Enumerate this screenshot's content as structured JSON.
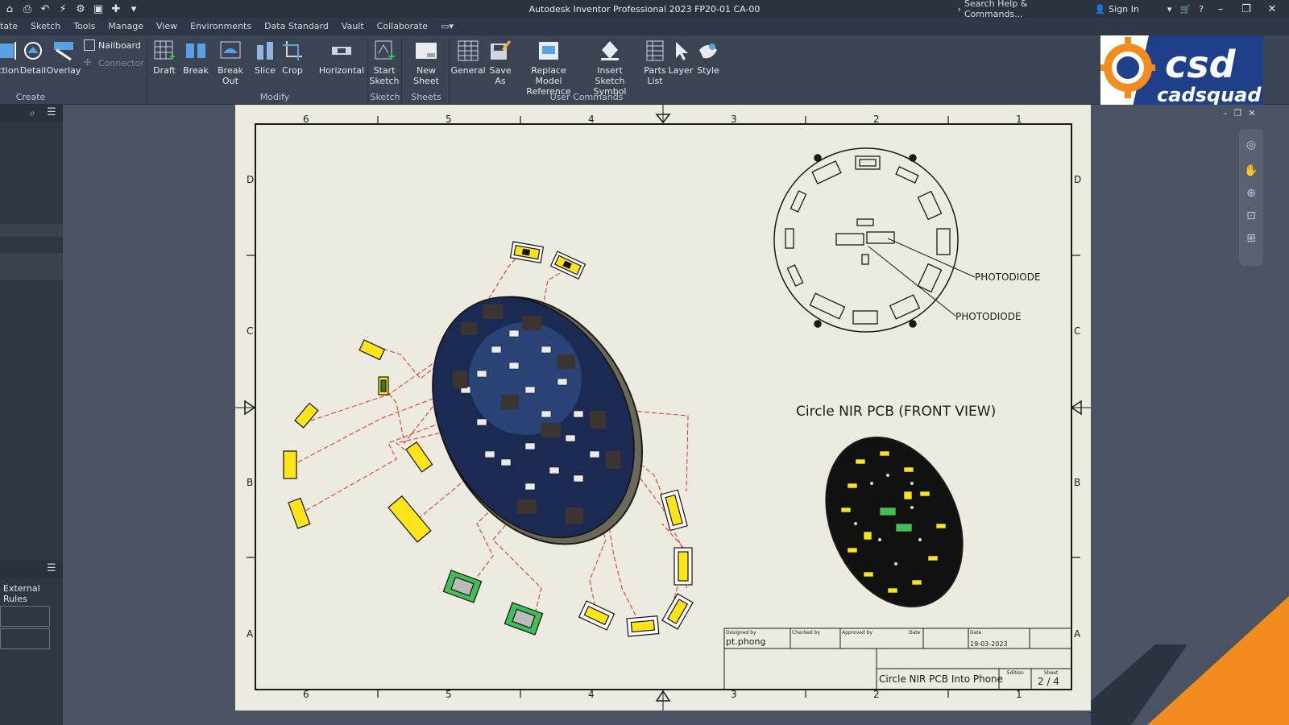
{
  "app": {
    "title": "Autodesk Inventor Professional 2023   FP20-01 CA-00"
  },
  "title_bar": {
    "search_placeholder": "Search Help & Commands...",
    "sign_in": "Sign In"
  },
  "menu": {
    "tabs": [
      "tate",
      "Sketch",
      "Tools",
      "Manage",
      "View",
      "Environments",
      "Data Standard",
      "Vault",
      "Collaborate"
    ]
  },
  "ribbon": {
    "groups": {
      "create": "Create",
      "modify": "Modify",
      "sketch": "Sketch",
      "sheets": "Sheets",
      "user_commands": "User Commands"
    },
    "buttons": {
      "section": "ction",
      "detail": "Detail",
      "overlay": "Overlay",
      "nailboard": "Nailboard",
      "connector": "Connector",
      "draft": "Draft",
      "break": "Break",
      "break_out": "Break Out",
      "slice": "Slice",
      "crop": "Crop",
      "horizontal": "Horizontal",
      "start_sketch_1": "Start",
      "start_sketch_2": "Sketch",
      "new_sheet": "New Sheet",
      "general": "General",
      "save_as": "Save As",
      "replace_model_1": "Replace Model",
      "replace_model_2": "Reference",
      "insert_symbol_1": "Insert",
      "insert_symbol_2": "Sketch Symbol",
      "parts_list_1": "Parts",
      "parts_list_2": "List",
      "layer": "Layer",
      "style": "Style"
    }
  },
  "left_panel": {
    "external_rules": "External Rules"
  },
  "logo": {
    "line1": "csd",
    "line2": "cadsquad"
  },
  "drawing": {
    "zones_top": [
      "6",
      "5",
      "4",
      "3",
      "2",
      "1"
    ],
    "zones_side": [
      "D",
      "C",
      "B",
      "A"
    ],
    "front_view_title": "Circle NIR PCB (FRONT VIEW)",
    "callouts": [
      "PHOTODIODE",
      "PHOTODIODE"
    ],
    "title_block": {
      "designed_by_label": "Designed by",
      "designed_by": "pt.phong",
      "checked_by_label": "Checked by",
      "approved_by_label": "Approved by",
      "date_label_1": "Date",
      "date_label_2": "Date",
      "date": "19-03-2023",
      "title": "Circle NIR PCB Into Phone",
      "edition_label": "Edition",
      "sheet_label": "Sheet",
      "sheet": "2 / 4"
    }
  },
  "colors": {
    "ribbon_bg": "#3b4453",
    "sheet_bg": "#edebe0",
    "accent_orange": "#f28c1e",
    "logo_blue": "#1f3f8a",
    "leader_red": "#e0302a",
    "component_yellow": "#ffe41a"
  }
}
